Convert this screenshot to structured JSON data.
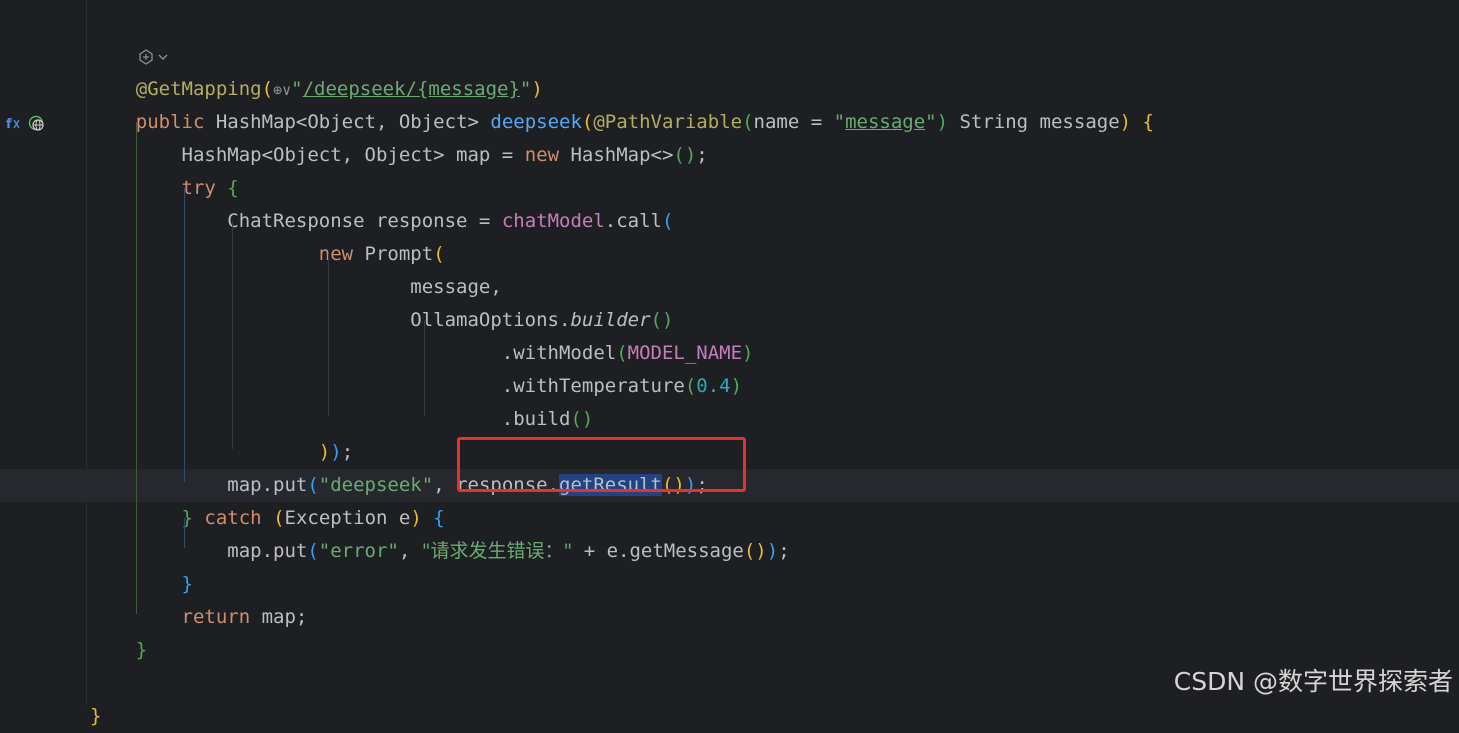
{
  "editor": {
    "lines": [
      {
        "tokens": [
          {
            "t": "  ",
            "c": ""
          }
        ]
      },
      {
        "tokens": [
          {
            "t": "    ",
            "c": ""
          },
          {
            "t": "@GetMapping",
            "c": "ann"
          },
          {
            "t": "(",
            "c": "br1"
          },
          {
            "t": "⊕∨",
            "c": "inlay"
          },
          {
            "t": "\"",
            "c": "str"
          },
          {
            "t": "/deepseek/{message}",
            "c": "str ul"
          },
          {
            "t": "\"",
            "c": "str"
          },
          {
            "t": ")",
            "c": "br1"
          }
        ]
      },
      {
        "tokens": [
          {
            "t": "    ",
            "c": ""
          },
          {
            "t": "public",
            "c": "kw"
          },
          {
            "t": " HashMap<Object, Object> ",
            "c": ""
          },
          {
            "t": "deepseek",
            "c": "fn"
          },
          {
            "t": "(",
            "c": "br1"
          },
          {
            "t": "@PathVariable",
            "c": "ann"
          },
          {
            "t": "(",
            "c": "br2"
          },
          {
            "t": "name = ",
            "c": ""
          },
          {
            "t": "\"",
            "c": "str"
          },
          {
            "t": "message",
            "c": "str ul"
          },
          {
            "t": "\"",
            "c": "str"
          },
          {
            "t": ")",
            "c": "br2"
          },
          {
            "t": " String message",
            "c": ""
          },
          {
            "t": ")",
            "c": "br1"
          },
          {
            "t": " ",
            "c": ""
          },
          {
            "t": "{",
            "c": "br1"
          }
        ]
      },
      {
        "tokens": [
          {
            "t": "        HashMap<Object, Object> map = ",
            "c": ""
          },
          {
            "t": "new",
            "c": "kw"
          },
          {
            "t": " HashMap<>",
            "c": ""
          },
          {
            "t": "()",
            "c": "br2"
          },
          {
            "t": ";",
            "c": ""
          }
        ]
      },
      {
        "tokens": [
          {
            "t": "        ",
            "c": ""
          },
          {
            "t": "try",
            "c": "kw"
          },
          {
            "t": " ",
            "c": ""
          },
          {
            "t": "{",
            "c": "br2"
          }
        ]
      },
      {
        "tokens": [
          {
            "t": "            ChatResponse response = ",
            "c": ""
          },
          {
            "t": "chatModel",
            "c": "field"
          },
          {
            "t": ".call",
            "c": ""
          },
          {
            "t": "(",
            "c": "br3"
          }
        ]
      },
      {
        "tokens": [
          {
            "t": "                    ",
            "c": ""
          },
          {
            "t": "new",
            "c": "kw"
          },
          {
            "t": " Prompt",
            "c": ""
          },
          {
            "t": "(",
            "c": "br1"
          }
        ]
      },
      {
        "tokens": [
          {
            "t": "                            message,",
            "c": ""
          }
        ]
      },
      {
        "tokens": [
          {
            "t": "                            OllamaOptions.",
            "c": ""
          },
          {
            "t": "builder",
            "c": "italic"
          },
          {
            "t": "()",
            "c": "br2"
          }
        ]
      },
      {
        "tokens": [
          {
            "t": "                                    .withModel",
            "c": ""
          },
          {
            "t": "(",
            "c": "br2"
          },
          {
            "t": "MODEL_NAME",
            "c": "field"
          },
          {
            "t": ")",
            "c": "br2"
          }
        ]
      },
      {
        "tokens": [
          {
            "t": "                                    .withTemperature",
            "c": ""
          },
          {
            "t": "(",
            "c": "br2"
          },
          {
            "t": "0.4",
            "c": "num"
          },
          {
            "t": ")",
            "c": "br2"
          }
        ]
      },
      {
        "tokens": [
          {
            "t": "                                    .build",
            "c": ""
          },
          {
            "t": "()",
            "c": "br2"
          }
        ]
      },
      {
        "tokens": [
          {
            "t": "                    ",
            "c": ""
          },
          {
            "t": ")",
            "c": "br1"
          },
          {
            "t": ")",
            "c": "br3"
          },
          {
            "t": ";",
            "c": ""
          }
        ]
      },
      {
        "tokens": [
          {
            "t": "            map.put",
            "c": ""
          },
          {
            "t": "(",
            "c": "br3"
          },
          {
            "t": "\"deepseek\"",
            "c": "str"
          },
          {
            "t": ", response.",
            "c": ""
          },
          {
            "t": "getResult",
            "c": "hl"
          },
          {
            "t": "()",
            "c": "br1"
          },
          {
            "t": ")",
            "c": "br3"
          },
          {
            "t": ";",
            "c": ""
          }
        ]
      },
      {
        "tokens": [
          {
            "t": "        ",
            "c": ""
          },
          {
            "t": "}",
            "c": "br2"
          },
          {
            "t": " ",
            "c": ""
          },
          {
            "t": "catch",
            "c": "kw"
          },
          {
            "t": " ",
            "c": ""
          },
          {
            "t": "(",
            "c": "br1"
          },
          {
            "t": "Exception e",
            "c": ""
          },
          {
            "t": ")",
            "c": "br1"
          },
          {
            "t": " ",
            "c": ""
          },
          {
            "t": "{",
            "c": "br3"
          }
        ]
      },
      {
        "tokens": [
          {
            "t": "            map.put",
            "c": ""
          },
          {
            "t": "(",
            "c": "br3"
          },
          {
            "t": "\"error\"",
            "c": "str"
          },
          {
            "t": ", ",
            "c": ""
          },
          {
            "t": "\"请求发生错误：\"",
            "c": "str cjk"
          },
          {
            "t": " + e.getMessage",
            "c": ""
          },
          {
            "t": "()",
            "c": "br1"
          },
          {
            "t": ")",
            "c": "br3"
          },
          {
            "t": ";",
            "c": ""
          }
        ]
      },
      {
        "tokens": [
          {
            "t": "        ",
            "c": ""
          },
          {
            "t": "}",
            "c": "br3"
          }
        ]
      },
      {
        "tokens": [
          {
            "t": "        ",
            "c": ""
          },
          {
            "t": "return",
            "c": "kw"
          },
          {
            "t": " map;",
            "c": ""
          }
        ]
      },
      {
        "tokens": [
          {
            "t": "    ",
            "c": ""
          },
          {
            "t": "}",
            "c": "br2"
          }
        ]
      },
      {
        "tokens": [
          {
            "t": "  ",
            "c": ""
          }
        ]
      },
      {
        "tokens": [
          {
            "t": "",
            "c": ""
          },
          {
            "t": "}",
            "c": "br1"
          }
        ]
      }
    ]
  },
  "watermark": "CSDN @数字世界探索者"
}
